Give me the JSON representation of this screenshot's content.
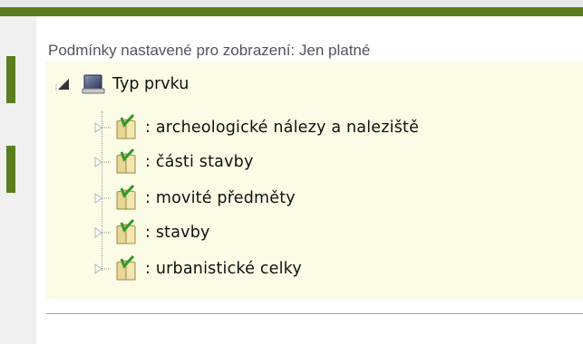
{
  "conditions_text": "Podmínky nastavené pro zobrazení: Jen platné",
  "tree": {
    "root": {
      "label": "Typ prvku",
      "icon": "monitor-icon",
      "expanded": true
    },
    "items": [
      {
        "label": ": archeologické nálezy a naleziště",
        "icon": "folder-check-icon"
      },
      {
        "label": ": části stavby",
        "icon": "folder-check-icon"
      },
      {
        "label": ": movité předměty",
        "icon": "folder-check-icon"
      },
      {
        "label": " : stavby",
        "icon": "folder-check-icon"
      },
      {
        "label": ": urbanistické celky",
        "icon": "folder-check-icon"
      }
    ]
  },
  "colors": {
    "accent_green": "#5a7d1e",
    "tree_background": "#fbfbe6",
    "conditions_text": "#555555"
  }
}
